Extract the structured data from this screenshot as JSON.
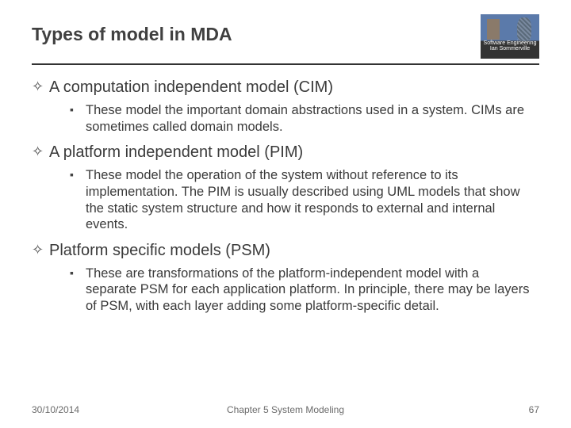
{
  "title": "Types of model in MDA",
  "logo": {
    "line1": "Software Engineering",
    "line2": "Ian Sommerville"
  },
  "items": [
    {
      "heading": "A computation independent model (CIM)",
      "detail": "These model the important domain abstractions used in a system. CIMs are sometimes called domain models."
    },
    {
      "heading": "A platform independent model (PIM)",
      "detail": "These model the operation of the system without reference to its implementation. The PIM is usually described using UML models that show the static system structure and how it responds to external and internal events."
    },
    {
      "heading": "Platform specific models (PSM)",
      "detail": "These are transformations of the platform-independent model with a separate PSM for each application platform. In principle, there may be layers of PSM, with each layer adding some platform-specific detail."
    }
  ],
  "footer": {
    "date": "30/10/2014",
    "chapter": "Chapter 5 System Modeling",
    "page": "67"
  }
}
